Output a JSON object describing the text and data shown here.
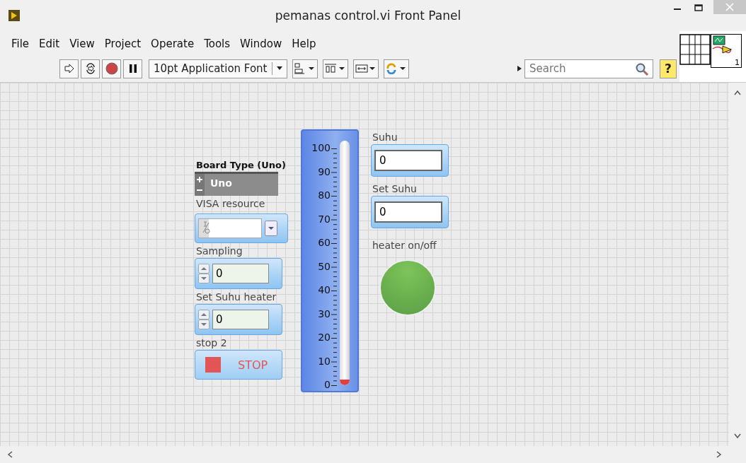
{
  "window": {
    "title": "pemanas control.vi Front Panel"
  },
  "menu": [
    "File",
    "Edit",
    "View",
    "Project",
    "Operate",
    "Tools",
    "Window",
    "Help"
  ],
  "toolbar": {
    "font": "10pt Application Font",
    "search": {
      "placeholder": "Search"
    },
    "help": "?",
    "connector_number": "1"
  },
  "controls": [
    {
      "kind": "ring",
      "label": "Board Type (Uno)",
      "value": "Uno"
    },
    {
      "kind": "visa",
      "label": "VISA resource"
    },
    {
      "kind": "numeric",
      "label": "Sampling",
      "value": "0"
    },
    {
      "kind": "numeric",
      "label": "Set Suhu heater",
      "value": "0"
    },
    {
      "kind": "stop",
      "label": "stop 2",
      "text": "STOP"
    }
  ],
  "thermometer": {
    "scale": [
      "100",
      "90",
      "80",
      "70",
      "60",
      "50",
      "40",
      "30",
      "20",
      "10",
      "0"
    ],
    "level": 0
  },
  "indicators": [
    {
      "kind": "numeric",
      "label": "Suhu",
      "value": "0"
    },
    {
      "kind": "numeric",
      "label": "Set Suhu",
      "value": "0"
    },
    {
      "kind": "led",
      "label": "heater on/off",
      "on": true
    }
  ]
}
